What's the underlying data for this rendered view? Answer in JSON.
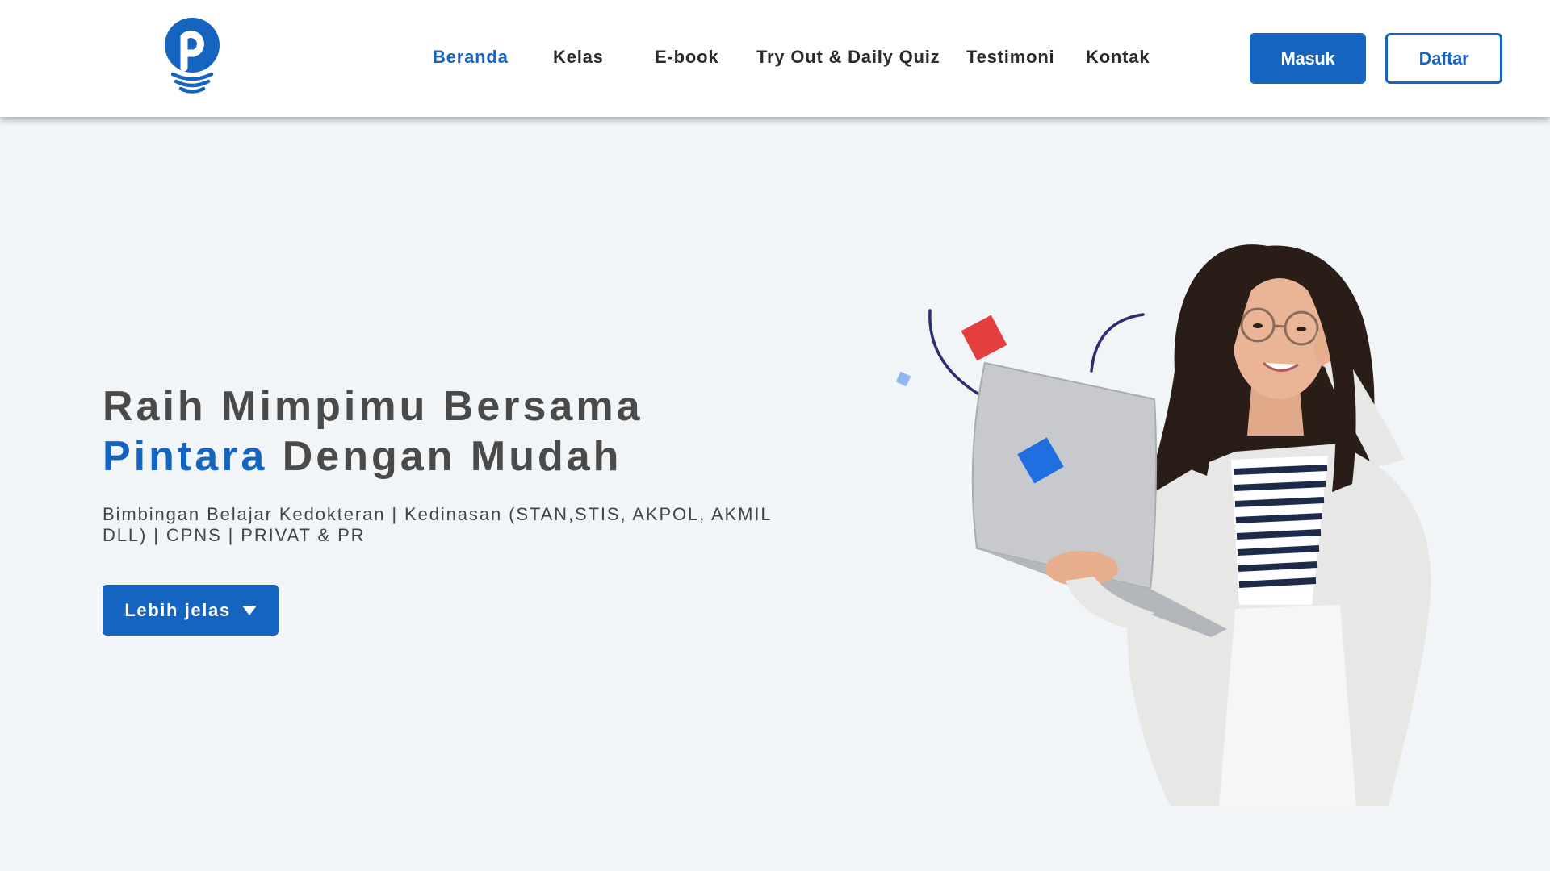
{
  "nav": {
    "links": [
      {
        "label": "Beranda",
        "active": true
      },
      {
        "label": "Kelas",
        "active": false
      },
      {
        "label": "E-book",
        "active": false
      },
      {
        "label": "Try Out & Daily Quiz",
        "active": false
      },
      {
        "label": "Testimoni",
        "active": false
      },
      {
        "label": "Kontak",
        "active": false
      }
    ],
    "login_label": "Masuk",
    "register_label": "Daftar"
  },
  "hero": {
    "title_line1": "Raih Mimpimu Bersama",
    "title_brand": "Pintara",
    "title_line2_rest": " Dengan Mudah",
    "subtitle": "Bimbingan Belajar Kedokteran | Kedinasan (STAN,STIS, AKPOL, AKMIL DLL) | CPNS | PRIVAT & PR",
    "cta_label": "Lebih jelas",
    "cta_icon": "caret-down-icon"
  },
  "colors": {
    "primary": "#1565c0",
    "text_dark": "#4a4a4a",
    "background": "#f2f5f8",
    "navbar": "#ffffff"
  }
}
